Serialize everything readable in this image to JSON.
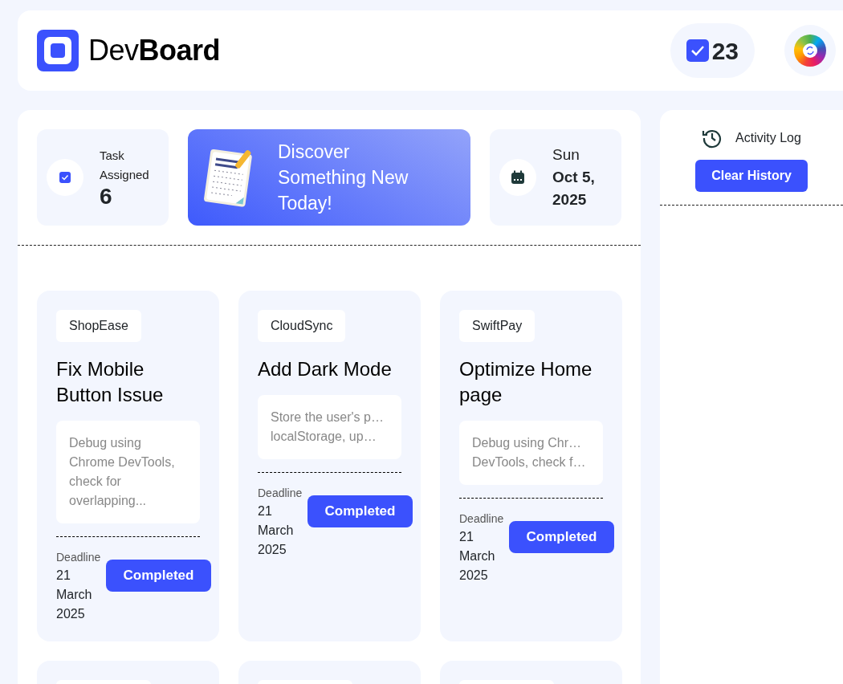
{
  "header": {
    "logo": "Dev**Board**",
    "task_count": "23"
  },
  "stats": {
    "assigned": {
      "label": "Task Assigned",
      "value": "6"
    },
    "banner": {
      "text": "Discover Something New Today!"
    },
    "date": {
      "weekday": "Sun",
      "date": "Oct 5, 2025"
    }
  },
  "tasks": [
    {
      "kind": "full",
      "project": "ShopEase",
      "title": "Fix Mobile Button Issue",
      "description_lines": [
        "Debug using",
        "Chrome DevTools,",
        "check for",
        "overlapping..."
      ],
      "deadline_label": "Deadline",
      "deadline": "21 March 2025",
      "status": "Completed"
    },
    {
      "kind": "full",
      "project": "CloudSync",
      "title": "Add Dark Mode",
      "description_lines": [
        "Store the user's p…",
        "localStorage, up…"
      ],
      "deadline_label": "Deadline",
      "deadline": "21 March 2025",
      "status": "Completed"
    },
    {
      "kind": "full",
      "project": "SwiftPay",
      "title": "Optimize Home page",
      "description_lines": [
        "Debug using Chr…",
        "DevTools, check f…"
      ],
      "deadline_label": "Deadline",
      "deadline": "21 March 2025",
      "status": "Completed"
    },
    {
      "kind": "cut-off"
    },
    {
      "kind": "cut-off"
    },
    {
      "kind": "cut-off"
    }
  ],
  "activity": {
    "title": "Activity Log",
    "button": "Clear History"
  }
}
